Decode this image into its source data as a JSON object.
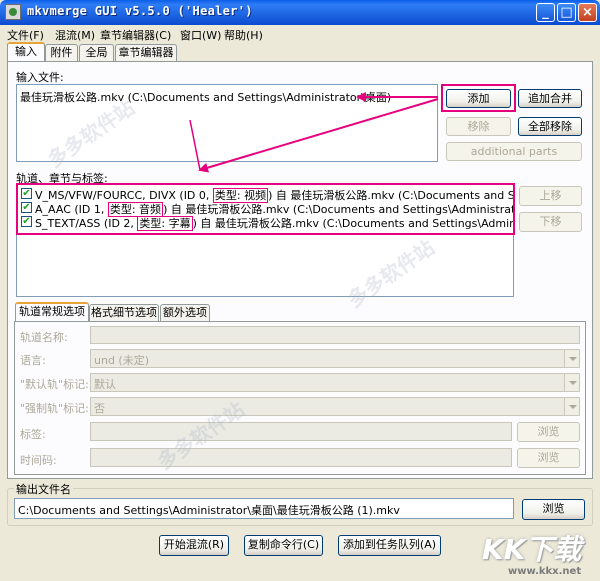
{
  "window": {
    "title": "mkvmerge GUI v5.5.0 ('Healer')",
    "minimize_glyph": "_",
    "maximize_glyph": "□",
    "close_glyph": "×"
  },
  "menu": [
    "文件(F)",
    "混流(M)",
    "章节编辑器(C)",
    "窗口(W)",
    "帮助(H)"
  ],
  "main_tabs": [
    "输入",
    "附件",
    "全局",
    "章节编辑器"
  ],
  "input_files": {
    "label": "输入文件:",
    "items": [
      "最佳玩滑板公路.mkv (C:\\Documents and Settings\\Administrator\\桌面)"
    ],
    "buttons": {
      "add": "添加",
      "append": "追加合并",
      "remove": "移除",
      "remove_all": "全部移除",
      "additional": "additional parts"
    }
  },
  "tracks": {
    "label": "轨道、章节与标签:",
    "items": [
      {
        "pre": "V_MS/VFW/FOURCC, DIVX (ID 0, ",
        "type": "类型: 视频",
        "post": ") 自 最佳玩滑板公路.mkv (C:\\Documents and Settings\\Ad"
      },
      {
        "pre": "A_AAC (ID 1, ",
        "type": "类型: 音频",
        "post": ") 自 最佳玩滑板公路.mkv (C:\\Documents and Settings\\Administrator\\桌面)"
      },
      {
        "pre": "S_TEXT/ASS (ID 2, ",
        "type": "类型: 字幕",
        "post": ") 自 最佳玩滑板公路.mkv (C:\\Documents and Settings\\Administrator\\桌"
      }
    ],
    "checkmark": "✔",
    "up": "上移",
    "down": "下移"
  },
  "sub_tabs": [
    "轨道常规选项",
    "格式细节选项",
    "额外选项"
  ],
  "options": {
    "track_name_label": "轨道名称:",
    "language_label": "语言:",
    "language_value": "und (未定)",
    "default_label": "\"默认轨\"标记:",
    "default_value": "默认",
    "forced_label": "\"强制轨\"标记:",
    "forced_value": "否",
    "tags_label": "标签:",
    "timecodes_label": "时间码:",
    "browse": "浏览"
  },
  "output": {
    "label": "输出文件名",
    "value": "C:\\Documents and Settings\\Administrator\\桌面\\最佳玩滑板公路 (1).mkv",
    "browse": "浏览"
  },
  "bottom_buttons": [
    "开始混流(R)",
    "复制命令行(C)",
    "添加到任务队列(A)"
  ],
  "watermark": "多多软件站",
  "brand": {
    "name": "KK下载",
    "url": "www.kkx.net"
  },
  "colors": {
    "annotation": "#e6007e",
    "title_bar": "#0a5ee8"
  }
}
